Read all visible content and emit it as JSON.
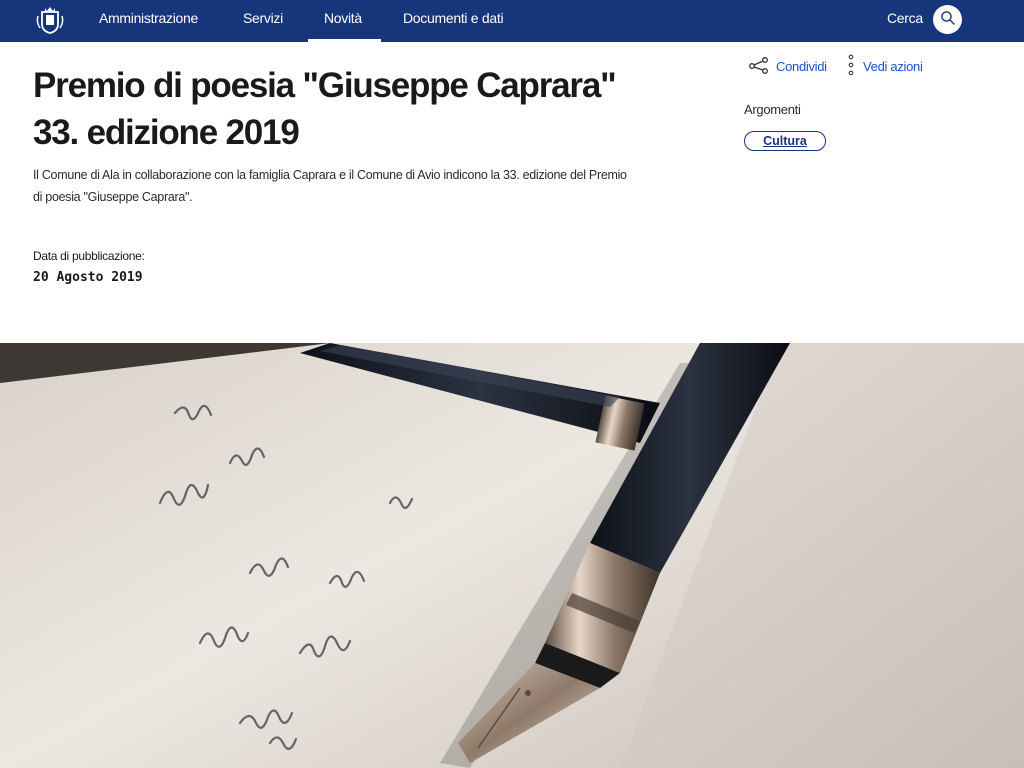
{
  "nav": {
    "items": [
      {
        "label": "Amministrazione",
        "active": false
      },
      {
        "label": "Servizi",
        "active": false
      },
      {
        "label": "Novità",
        "active": true
      },
      {
        "label": "Documenti e dati",
        "active": false
      }
    ],
    "search_label": "Cerca",
    "search_icon": "search-icon",
    "logo_icon": "municipality-crest-icon"
  },
  "article": {
    "title_line1": "Premio di poesia \"Giuseppe Caprara\"",
    "title_line2": "33. edizione 2019",
    "description": "Il Comune di Ala in collaborazione con la famiglia Caprara e il Comune di Avio indicono la 33. edizione del Premio di poesia \"Giuseppe Caprara\".",
    "publication_label": "Data di pubblicazione:",
    "publication_date": "20 Agosto 2019"
  },
  "sidebar": {
    "share_label": "Condividi",
    "share_icon": "share-icon",
    "actions_label": "Vedi azioni",
    "actions_icon": "more-vertical-icon",
    "topics_label": "Argomenti",
    "topics": [
      {
        "label": "Cultura"
      }
    ]
  },
  "hero": {
    "image_subject": "fountain-pen-on-handwritten-paper"
  },
  "colors": {
    "header_bg": "#17357a",
    "link": "#1f4fd1",
    "text": "#1a1a1a"
  }
}
